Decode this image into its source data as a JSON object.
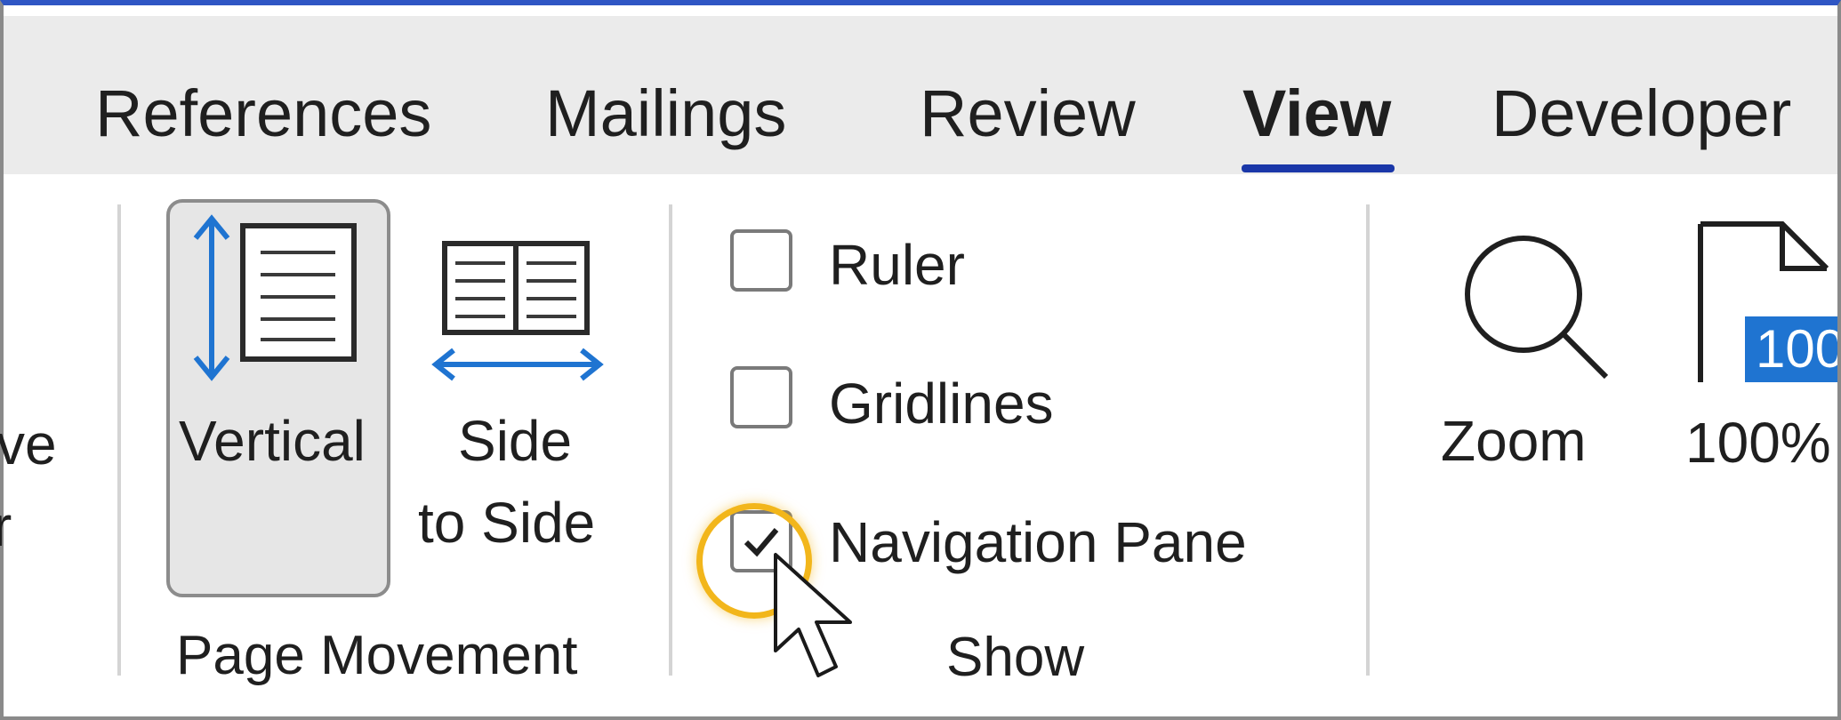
{
  "tabs": [
    {
      "label": "References"
    },
    {
      "label": "Mailings"
    },
    {
      "label": "Review"
    },
    {
      "label": "View"
    },
    {
      "label": "Developer"
    }
  ],
  "active_tab": "View",
  "ribbon": {
    "partial_left": {
      "line1": "ve",
      "line2": "r"
    },
    "page_movement": {
      "group_label": "Page Movement",
      "vertical_label": "Vertical",
      "vertical_selected": true,
      "side_line1": "Side",
      "side_line2": "to Side"
    },
    "show": {
      "group_label": "Show",
      "ruler": {
        "label": "Ruler",
        "checked": false
      },
      "gridlines": {
        "label": "Gridlines",
        "checked": false
      },
      "navigation_pane": {
        "label": "Navigation Pane",
        "checked": true
      }
    },
    "zoom": {
      "zoom_label": "Zoom",
      "percent_label": "100%",
      "percent_badge": "100"
    }
  },
  "colors": {
    "accent_blue": "#1f74d1",
    "underline_blue": "#1a37a8",
    "highlight_gold": "#f2b61b",
    "tab_bar_bg": "#ebebeb"
  },
  "icons": [
    "vertical-page-icon",
    "side-to-side-pages-icon",
    "checkmark-icon",
    "magnifier-icon",
    "page-100-icon",
    "mouse-cursor-icon"
  ]
}
